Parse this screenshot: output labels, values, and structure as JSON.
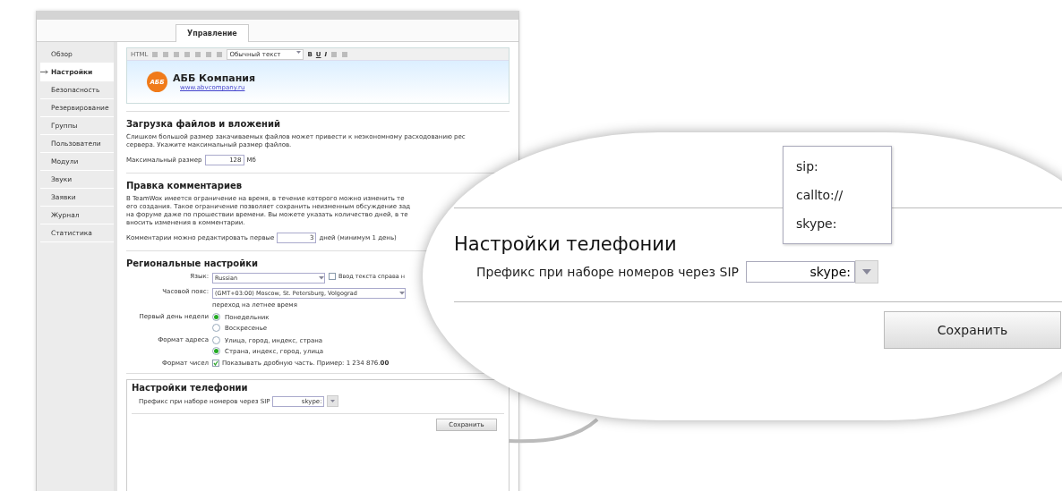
{
  "window": {
    "tabs": [
      {
        "label": "Управление",
        "selected": true
      }
    ]
  },
  "sidebar": {
    "items": [
      {
        "label": "Обзор",
        "selected": false
      },
      {
        "label": "Настройки",
        "selected": true
      },
      {
        "label": "Безопасность",
        "selected": false
      },
      {
        "label": "Резервирование",
        "selected": false
      },
      {
        "label": "Группы",
        "selected": false
      },
      {
        "label": "Пользователи",
        "selected": false
      },
      {
        "label": "Модули",
        "selected": false
      },
      {
        "label": "Звуки",
        "selected": false
      },
      {
        "label": "Заявки",
        "selected": false
      },
      {
        "label": "Журнал",
        "selected": false
      },
      {
        "label": "Статистика",
        "selected": false
      }
    ]
  },
  "editor": {
    "toolbar": {
      "html_label": "HTML",
      "style_select": "Обычный текст",
      "format_buttons": [
        {
          "kind": "bold",
          "label": "B"
        },
        {
          "kind": "underline",
          "label": "U"
        },
        {
          "kind": "italic",
          "label": "I"
        }
      ]
    },
    "logo_text": "АББ",
    "company_name": "АББ Компания",
    "company_link": "www.abvcompany.ru"
  },
  "uploads": {
    "title": "Загрузка файлов и вложений",
    "description_lines": [
      "Слишком большой размер закачиваемых файлов может привести к неэкономному расходованию рес",
      "сервера. Укажите максимальный размер файлов."
    ],
    "max_size_label": "Максимальный размер",
    "max_size_value": "128",
    "max_size_unit": "Мб"
  },
  "comments": {
    "title": "Правка комментариев",
    "description_lines": [
      "В TeamWox имеется ограничение на время, в течение которого можно изменить те",
      "его создания. Такое ограничение позволяет сохранить неизменным обсуждение зад",
      "на форуме даже по прошествии времени. Вы можете указать количество дней, в те",
      "вносить изменения в комментарии."
    ],
    "edit_label": "Комментарии можно редактировать первые",
    "edit_value": "3",
    "edit_hint": "дней (минимум 1 день)"
  },
  "regional": {
    "title": "Региональные настройки",
    "language": {
      "label": "Язык:",
      "value": "Russian",
      "rtl_checkbox": {
        "label": "Ввод текста справа н",
        "checked": false
      }
    },
    "timezone": {
      "label": "Часовой пояс:",
      "value": "(GMT+03:00) Moscow, St. Petersburg, Volgograd",
      "note": "переход на летнее время"
    },
    "first_day": {
      "label": "Первый день недели",
      "options": [
        {
          "label": "Понедельник",
          "selected": true
        },
        {
          "label": "Воскресенье",
          "selected": false
        }
      ]
    },
    "address_format": {
      "label": "Формат адреса",
      "options": [
        {
          "label": "Улица, город, индекс, страна",
          "selected": false
        },
        {
          "label": "Страна, индекс, город, улица",
          "selected": true
        }
      ]
    },
    "number_format": {
      "label": "Формат чисел",
      "checkbox": {
        "label": "Показывать дробную часть. Пример: 1 234 876.**00**",
        "checked": true
      }
    }
  },
  "telephony": {
    "title": "Настройки телефонии",
    "prefix_label": "Префикс при наборе номеров через SIP",
    "prefix_value": "skype:",
    "save_button": "Сохранить"
  },
  "callout": {
    "title": "Настройки телефонии",
    "prefix_label": "Префикс при наборе номеров через SIP",
    "prefix_value": "skype:",
    "dropdown_options": [
      {
        "label": "sip:"
      },
      {
        "label": "callto://"
      },
      {
        "label": "skype:"
      }
    ],
    "save_button": "Сохранить"
  }
}
